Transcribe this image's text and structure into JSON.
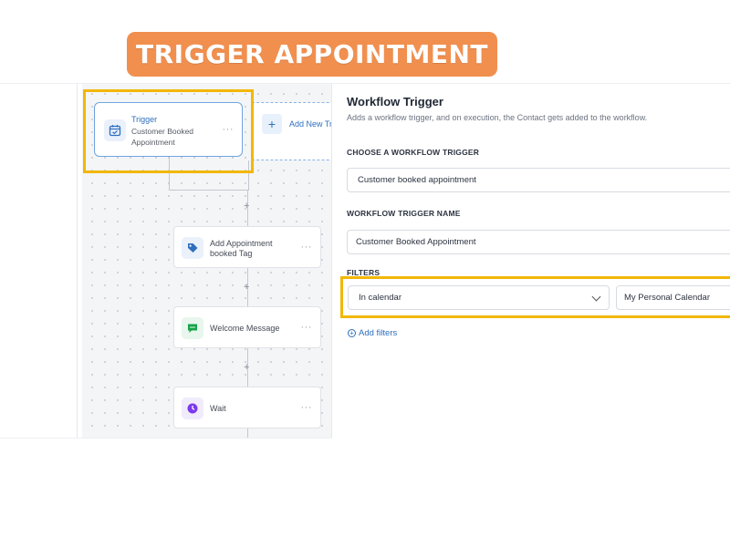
{
  "banner": {
    "title": "TRIGGER APPOINTMENT"
  },
  "canvas": {
    "trigger_node": {
      "title": "Trigger",
      "subtitle": "Customer Booked Appointment",
      "more": "···",
      "icon": "calendar-check-icon"
    },
    "add_trigger": {
      "plus": "+",
      "label": "Add New Trig"
    },
    "plus_sign": "+",
    "steps": [
      {
        "label": "Add Appointment booked Tag",
        "icon": "tag-icon",
        "icon_color": "#2f6fbe",
        "more": "···"
      },
      {
        "label": "Welcome Message",
        "icon": "chat-message-icon",
        "icon_color": "#17a34a",
        "more": "···"
      },
      {
        "label": "Wait",
        "icon": "clock-icon",
        "icon_color": "#7c3aed",
        "more": "···"
      }
    ]
  },
  "panel": {
    "title": "Workflow Trigger",
    "description": "Adds a workflow trigger, and on execution, the Contact gets added to the workflow.",
    "choose_label": "CHOOSE A WORKFLOW TRIGGER",
    "choose_value": "Customer booked appointment",
    "name_label": "WORKFLOW TRIGGER NAME",
    "name_value": "Customer Booked Appointment",
    "filters_label": "FILTERS",
    "filter_field": "In calendar",
    "filter_value": "My Personal Calendar",
    "add_filters": "Add filters",
    "add_filters_icon": "+"
  },
  "colors": {
    "banner": "#f18f4f",
    "highlight": "#f2b705",
    "accent": "#2f6fbe"
  }
}
